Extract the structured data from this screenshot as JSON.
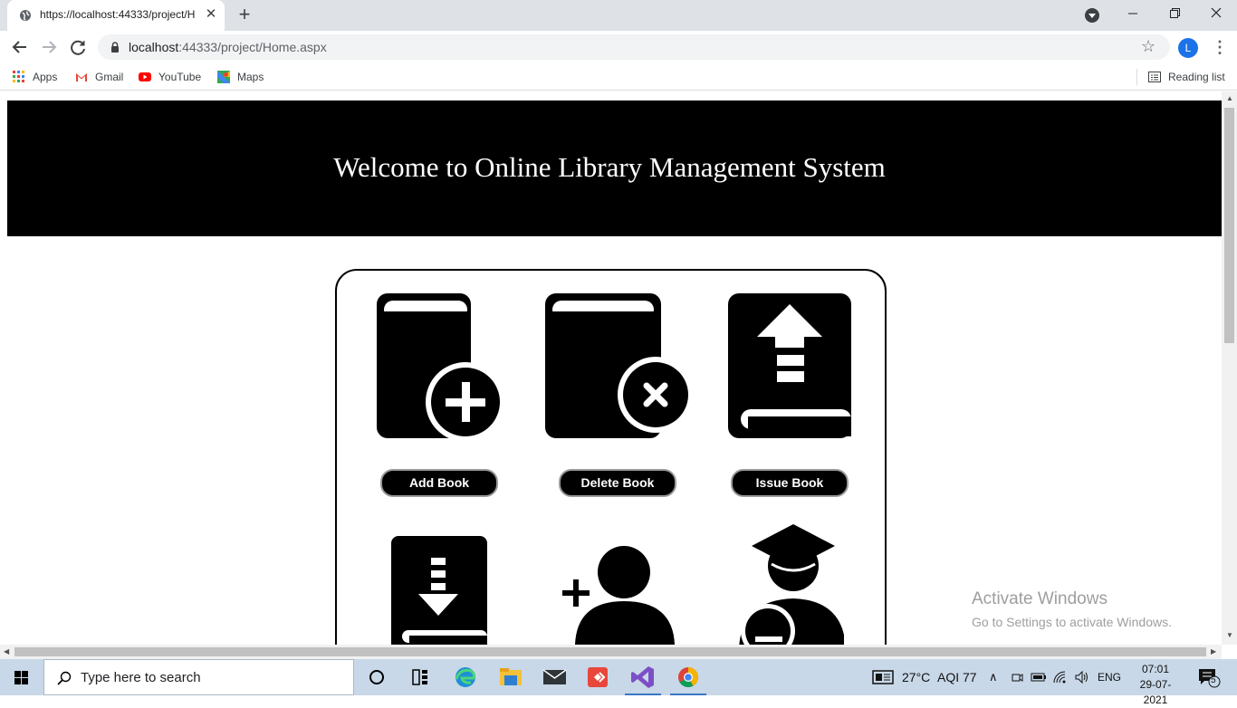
{
  "browser": {
    "tab_title": "https://localhost:44333/project/H",
    "url_host": "localhost",
    "url_path": ":44333/project/Home.aspx",
    "profile_initial": "L",
    "bookmarks": [
      {
        "label": "Apps",
        "icon": "apps-grid-icon"
      },
      {
        "label": "Gmail",
        "icon": "gmail-icon"
      },
      {
        "label": "YouTube",
        "icon": "youtube-icon"
      },
      {
        "label": "Maps",
        "icon": "maps-icon"
      }
    ],
    "reading_list": "Reading list"
  },
  "page": {
    "banner_title": "Welcome to Online Library Management System",
    "tiles": [
      {
        "label": "Add Book",
        "icon": "book-add-icon"
      },
      {
        "label": "Delete Book",
        "icon": "book-delete-icon"
      },
      {
        "label": "Issue Book",
        "icon": "book-issue-icon"
      },
      {
        "label": "",
        "icon": "book-return-icon"
      },
      {
        "label": "",
        "icon": "add-user-icon"
      },
      {
        "label": "",
        "icon": "student-icon"
      }
    ],
    "watermark": {
      "line1": "Activate Windows",
      "line2": "Go to Settings to activate Windows."
    }
  },
  "taskbar": {
    "search_placeholder": "Type here to search",
    "weather": "27°C",
    "aqi": "AQI 77",
    "language": "ENG",
    "time": "07:01",
    "date": "29-07-2021",
    "notifications": "5"
  },
  "colors": {
    "banner_bg": "#000000",
    "button_bg": "#000000",
    "chrome_tabstrip": "#dee1e6",
    "taskbar_bg": "#c8d8e8"
  }
}
